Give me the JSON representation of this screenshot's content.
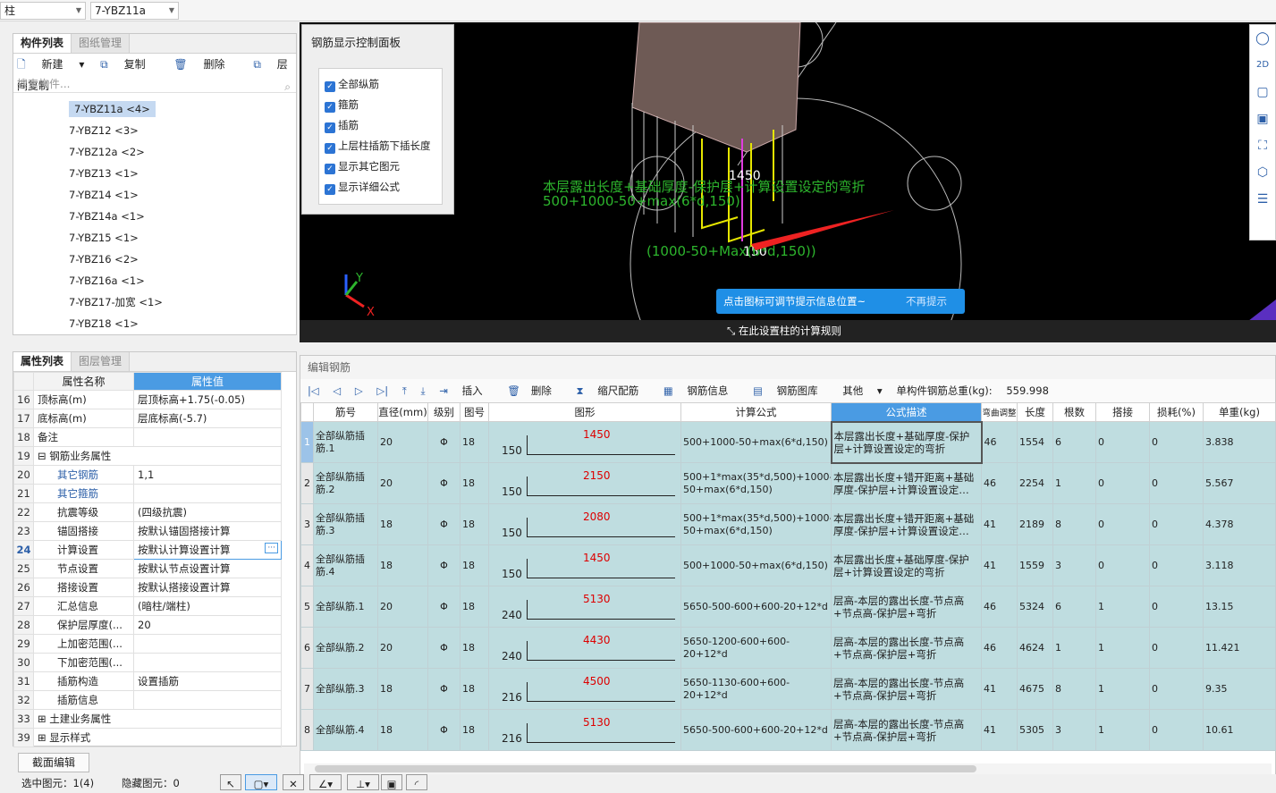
{
  "topbar": {
    "combo1": "柱",
    "combo2": "7-YBZ11a"
  },
  "component_panel": {
    "tabs": [
      "构件列表",
      "图纸管理"
    ],
    "tools": [
      "新建",
      "复制",
      "删除",
      "层间复制"
    ],
    "search_placeholder": "搜索构件...",
    "items": [
      "7-YBZ11a <4>",
      "7-YBZ12 <3>",
      "7-YBZ12a <2>",
      "7-YBZ13 <1>",
      "7-YBZ14 <1>",
      "7-YBZ14a <1>",
      "7-YBZ15 <1>",
      "7-YBZ16 <2>",
      "7-YBZ16a <1>",
      "7-YBZ17-加宽 <1>",
      "7-YBZ18 <1>"
    ]
  },
  "property_panel": {
    "tabs": [
      "属性列表",
      "图层管理"
    ],
    "col_name": "属性名称",
    "col_value": "属性值",
    "rows": [
      {
        "n": "16",
        "name": "顶标高(m)",
        "value": "层顶标高+1.75(-0.05)"
      },
      {
        "n": "17",
        "name": "底标高(m)",
        "value": "层底标高(-5.7)"
      },
      {
        "n": "18",
        "name": "备注",
        "value": ""
      },
      {
        "n": "19",
        "name": "钢筋业务属性",
        "value": ""
      },
      {
        "n": "20",
        "name": "其它钢筋",
        "value": "1,1"
      },
      {
        "n": "21",
        "name": "其它箍筋",
        "value": ""
      },
      {
        "n": "22",
        "name": "抗震等级",
        "value": "(四级抗震)"
      },
      {
        "n": "23",
        "name": "锚固搭接",
        "value": "按默认锚固搭接计算"
      },
      {
        "n": "24",
        "name": "计算设置",
        "value": "按默认计算设置计算"
      },
      {
        "n": "25",
        "name": "节点设置",
        "value": "按默认节点设置计算"
      },
      {
        "n": "26",
        "name": "搭接设置",
        "value": "按默认搭接设置计算"
      },
      {
        "n": "27",
        "name": "汇总信息",
        "value": "(暗柱/端柱)"
      },
      {
        "n": "28",
        "name": "保护层厚度(...",
        "value": "20"
      },
      {
        "n": "29",
        "name": "上加密范围(...",
        "value": ""
      },
      {
        "n": "30",
        "name": "下加密范围(...",
        "value": ""
      },
      {
        "n": "31",
        "name": "插筋构造",
        "value": "设置插筋"
      },
      {
        "n": "32",
        "name": "插筋信息",
        "value": ""
      },
      {
        "n": "33",
        "name": "土建业务属性",
        "value": ""
      },
      {
        "n": "39",
        "name": "显示样式",
        "value": ""
      }
    ],
    "section_button": "截面编辑"
  },
  "control_panel": {
    "title": "钢筋显示控制面板",
    "options": [
      "全部纵筋",
      "箍筋",
      "插筋",
      "上层柱插筋下插长度",
      "显示其它图元",
      "显示详细公式"
    ]
  },
  "view3d": {
    "label_1450": "1450",
    "label_150": "150",
    "formula_desc": "本层露出长度+基础厚度-保护层+计算设置设定的弯折",
    "formula_1": "500+1000-50+max(6*d,150)",
    "formula_2": "(1000-50+Max(6*d,150))",
    "tip": "点击图标可调节提示信息位置~",
    "tip_dismiss": "不再提示",
    "rule_strip": "在此设置柱的计算规则",
    "axis_x": "X",
    "axis_y": "Y"
  },
  "edit_panel": {
    "title": "编辑钢筋",
    "tools": [
      "插入",
      "删除",
      "缩尺配筋",
      "钢筋信息",
      "钢筋图库",
      "其他"
    ],
    "total_label": "单构件钢筋总重(kg):",
    "total_value": "559.998",
    "headers": [
      "筋号",
      "直径(mm)",
      "级别",
      "图号",
      "图形",
      "计算公式",
      "公式描述",
      "弯曲调整",
      "长度",
      "根数",
      "搭接",
      "损耗(%)",
      "单重(kg)"
    ],
    "grade_symbol": "Φ",
    "rows": [
      {
        "no": "1",
        "name": "全部纵筋插筋.1",
        "dia": "20",
        "fig": "18",
        "end": "150",
        "len": "1450",
        "formula": "500+1000-50+max(6*d,150)",
        "desc": "本层露出长度+基础厚度-保护层+计算设置设定的弯折",
        "bend": "46",
        "length": "1554",
        "count": "6",
        "lap": "0",
        "loss": "0",
        "weight": "3.838"
      },
      {
        "no": "2",
        "name": "全部纵筋插筋.2",
        "dia": "20",
        "fig": "18",
        "end": "150",
        "len": "2150",
        "formula": "500+1*max(35*d,500)+1000-50+max(6*d,150)",
        "desc": "本层露出长度+错开距离+基础厚度-保护层+计算设置设定…",
        "bend": "46",
        "length": "2254",
        "count": "1",
        "lap": "0",
        "loss": "0",
        "weight": "5.567"
      },
      {
        "no": "3",
        "name": "全部纵筋插筋.3",
        "dia": "18",
        "fig": "18",
        "end": "150",
        "len": "2080",
        "formula": "500+1*max(35*d,500)+1000-50+max(6*d,150)",
        "desc": "本层露出长度+错开距离+基础厚度-保护层+计算设置设定…",
        "bend": "41",
        "length": "2189",
        "count": "8",
        "lap": "0",
        "loss": "0",
        "weight": "4.378"
      },
      {
        "no": "4",
        "name": "全部纵筋插筋.4",
        "dia": "18",
        "fig": "18",
        "end": "150",
        "len": "1450",
        "formula": "500+1000-50+max(6*d,150)",
        "desc": "本层露出长度+基础厚度-保护层+计算设置设定的弯折",
        "bend": "41",
        "length": "1559",
        "count": "3",
        "lap": "0",
        "loss": "0",
        "weight": "3.118"
      },
      {
        "no": "5",
        "name": "全部纵筋.1",
        "dia": "20",
        "fig": "18",
        "end": "240",
        "len": "5130",
        "formula": "5650-500-600+600-20+12*d",
        "desc": "层高-本层的露出长度-节点高+节点高-保护层+弯折",
        "bend": "46",
        "length": "5324",
        "count": "6",
        "lap": "1",
        "loss": "0",
        "weight": "13.15"
      },
      {
        "no": "6",
        "name": "全部纵筋.2",
        "dia": "20",
        "fig": "18",
        "end": "240",
        "len": "4430",
        "formula": "5650-1200-600+600-20+12*d",
        "desc": "层高-本层的露出长度-节点高+节点高-保护层+弯折",
        "bend": "46",
        "length": "4624",
        "count": "1",
        "lap": "1",
        "loss": "0",
        "weight": "11.421"
      },
      {
        "no": "7",
        "name": "全部纵筋.3",
        "dia": "18",
        "fig": "18",
        "end": "216",
        "len": "4500",
        "formula": "5650-1130-600+600-20+12*d",
        "desc": "层高-本层的露出长度-节点高+节点高-保护层+弯折",
        "bend": "41",
        "length": "4675",
        "count": "8",
        "lap": "1",
        "loss": "0",
        "weight": "9.35"
      },
      {
        "no": "8",
        "name": "全部纵筋.4",
        "dia": "18",
        "fig": "18",
        "end": "216",
        "len": "5130",
        "formula": "5650-500-600+600-20+12*d",
        "desc": "层高-本层的露出长度-节点高+节点高-保护层+弯折",
        "bend": "41",
        "length": "5305",
        "count": "3",
        "lap": "1",
        "loss": "0",
        "weight": "10.61"
      }
    ]
  },
  "statusbar": {
    "selected": "选中图元：1(4)",
    "hidden": "隐藏图元：0"
  }
}
